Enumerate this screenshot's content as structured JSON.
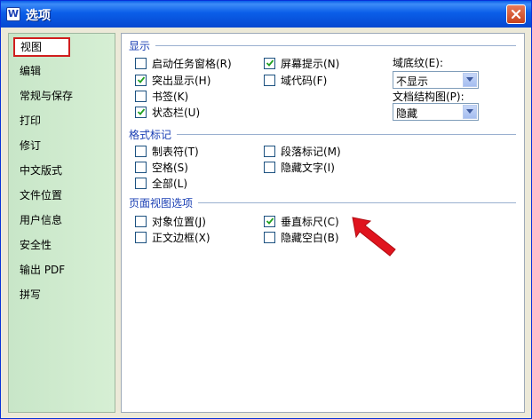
{
  "window": {
    "title": "选项",
    "app_icon_letter": "W"
  },
  "sidebar": {
    "items": [
      {
        "label": "视图",
        "selected": true
      },
      {
        "label": "编辑"
      },
      {
        "label": "常规与保存"
      },
      {
        "label": "打印"
      },
      {
        "label": "修订"
      },
      {
        "label": "中文版式"
      },
      {
        "label": "文件位置"
      },
      {
        "label": "用户信息"
      },
      {
        "label": "安全性"
      },
      {
        "label": "输出 PDF"
      },
      {
        "label": "拼写"
      }
    ]
  },
  "display": {
    "title": "显示",
    "startup_task_pane": {
      "label": "启动任务窗格(R)",
      "checked": false
    },
    "highlight": {
      "label": "突出显示(H)",
      "checked": true
    },
    "bookmarks": {
      "label": "书签(K)",
      "checked": false
    },
    "status_bar": {
      "label": "状态栏(U)",
      "checked": true
    },
    "screen_tips": {
      "label": "屏幕提示(N)",
      "checked": true
    },
    "field_codes": {
      "label": "域代码(F)",
      "checked": false
    },
    "field_shading": {
      "label": "域底纹(E):",
      "value": "不显示"
    },
    "doc_map": {
      "label": "文档结构图(P):",
      "value": "隐藏"
    }
  },
  "format_marks": {
    "title": "格式标记",
    "tab_chars": {
      "label": "制表符(T)",
      "checked": false
    },
    "spaces": {
      "label": "空格(S)",
      "checked": false
    },
    "all": {
      "label": "全部(L)",
      "checked": false
    },
    "paragraph_marks": {
      "label": "段落标记(M)",
      "checked": false
    },
    "hidden_text": {
      "label": "隐藏文字(I)",
      "checked": false
    }
  },
  "page_view": {
    "title": "页面视图选项",
    "object_anchors": {
      "label": "对象位置(J)",
      "checked": false
    },
    "text_boundaries": {
      "label": "正文边框(X)",
      "checked": false
    },
    "vertical_ruler": {
      "label": "垂直标尺(C)",
      "checked": true
    },
    "hide_white_space": {
      "label": "隐藏空白(B)",
      "checked": false
    }
  },
  "colors": {
    "annotation_arrow": "#e0141e",
    "group_title": "#1a3fb4",
    "selected_border": "#d01e1e"
  }
}
